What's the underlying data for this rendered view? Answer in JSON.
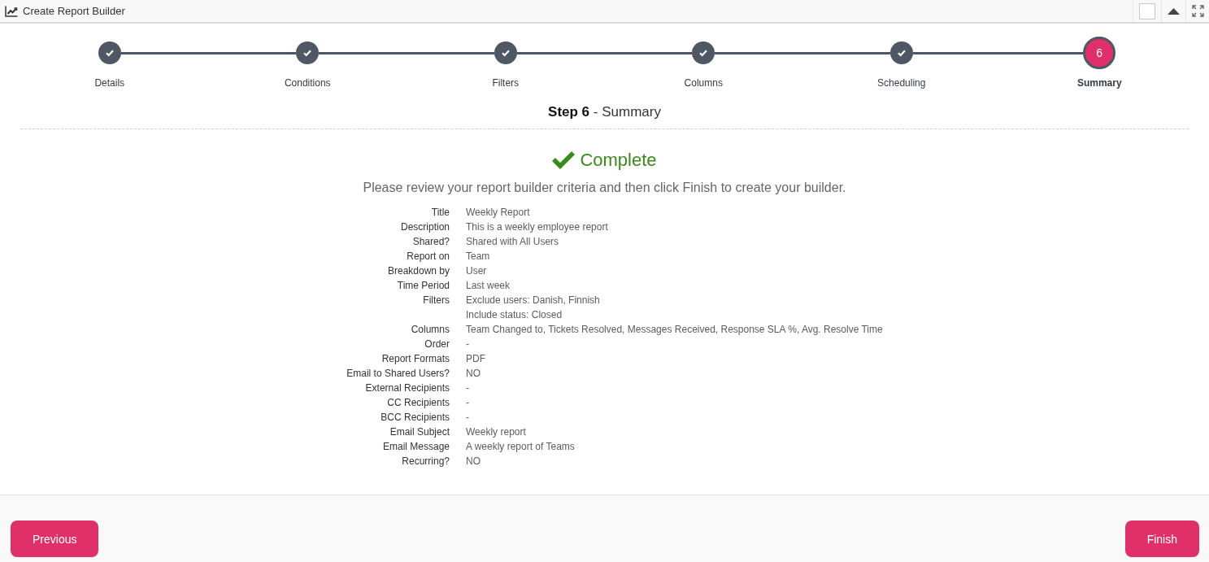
{
  "window": {
    "title": "Create Report Builder"
  },
  "steps": [
    {
      "label": "Details",
      "completed": true,
      "selected": false
    },
    {
      "label": "Conditions",
      "completed": true,
      "selected": false
    },
    {
      "label": "Filters",
      "completed": true,
      "selected": false
    },
    {
      "label": "Columns",
      "completed": true,
      "selected": false
    },
    {
      "label": "Scheduling",
      "completed": true,
      "selected": false
    },
    {
      "label": "Summary",
      "number": "6",
      "completed": false,
      "selected": true
    }
  ],
  "step_heading": "**Step 6** - Summary",
  "status": {
    "title": "Complete"
  },
  "instructions": "Please review your report builder criteria and then click Finish to create your builder.",
  "summary": [
    {
      "label": "Title",
      "values": [
        "Weekly Report"
      ]
    },
    {
      "label": "Description",
      "values": [
        "This is a weekly employee report"
      ]
    },
    {
      "label": "Shared?",
      "values": [
        "Shared with All Users"
      ]
    },
    {
      "label": "Report on",
      "values": [
        "Team"
      ]
    },
    {
      "label": "Breakdown by",
      "values": [
        "User"
      ]
    },
    {
      "label": "Time Period",
      "values": [
        "Last week"
      ]
    },
    {
      "label": "Filters",
      "values": [
        "Exclude users: Danish, Finnish",
        "Include status: Closed"
      ]
    },
    {
      "label": "Columns",
      "values": [
        "Team Changed to, Tickets Resolved, Messages Received, Response SLA %, Avg. Resolve Time"
      ]
    },
    {
      "label": "Order",
      "values": [
        "-"
      ]
    },
    {
      "label": "Report Formats",
      "values": [
        "PDF"
      ]
    },
    {
      "label": "Email to Shared Users?",
      "values": [
        "NO"
      ]
    },
    {
      "label": "External Recipients",
      "values": [
        "-"
      ]
    },
    {
      "label": "CC Recipients",
      "values": [
        "-"
      ]
    },
    {
      "label": "BCC Recipients",
      "values": [
        "-"
      ]
    },
    {
      "label": "Email Subject",
      "values": [
        "Weekly report"
      ]
    },
    {
      "label": "Email Message",
      "values": [
        "A weekly report of Teams"
      ]
    },
    {
      "label": "Recurring?",
      "values": [
        "NO"
      ]
    }
  ],
  "footer": {
    "buttons": [
      {
        "label": "Previous"
      },
      {
        "label": "Finish"
      }
    ]
  }
}
